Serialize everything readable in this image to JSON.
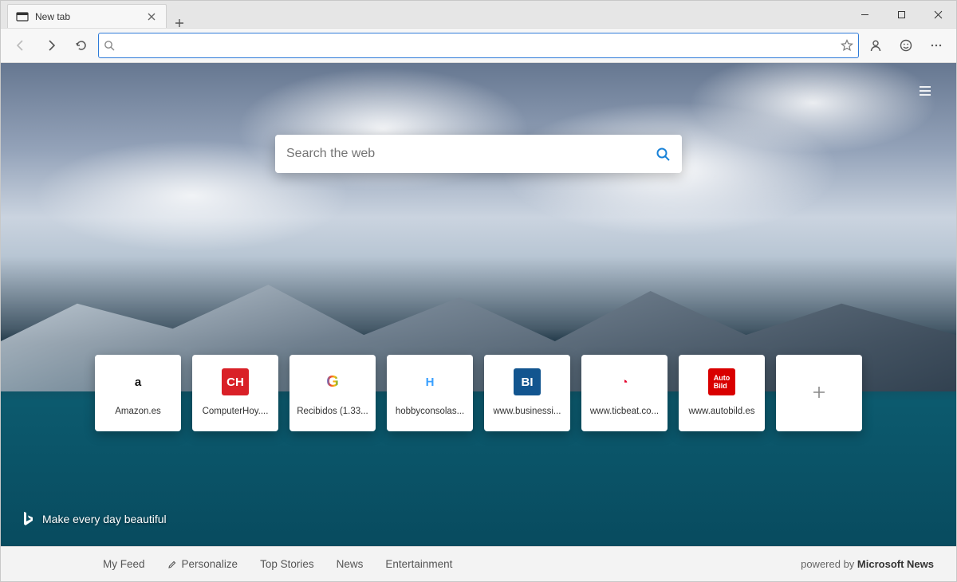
{
  "window": {
    "tab_title": "New tab"
  },
  "address_bar": {
    "value": "",
    "placeholder": ""
  },
  "page_search": {
    "placeholder": "Search the web"
  },
  "tiles": [
    {
      "label": "Amazon.es",
      "icon_text": "a",
      "icon_bg": "#ffffff",
      "icon_fg": "#111111"
    },
    {
      "label": "ComputerHoy....",
      "icon_text": "CH",
      "icon_bg": "#d92027",
      "icon_fg": "#ffffff"
    },
    {
      "label": "Recibidos (1.33...",
      "icon_text": "G",
      "icon_bg": "#ffffff",
      "icon_fg": "#4285f4"
    },
    {
      "label": "hobbyconsolas...",
      "icon_text": "H",
      "icon_bg": "#ffffff",
      "icon_fg": "#3aa0ff"
    },
    {
      "label": "www.businessi...",
      "icon_text": "BI",
      "icon_bg": "#12558f",
      "icon_fg": "#ffffff"
    },
    {
      "label": "www.ticbeat.co...",
      "icon_text": "◔",
      "icon_bg": "#ffffff",
      "icon_fg": "#e4002b"
    },
    {
      "label": "www.autobild.es",
      "icon_text": "Auto",
      "icon_bg": "#d90000",
      "icon_fg": "#ffffff"
    }
  ],
  "tagline": "Make every day beautiful",
  "footer": {
    "links": [
      "My Feed",
      "Personalize",
      "Top Stories",
      "News",
      "Entertainment"
    ],
    "powered_prefix": "powered by ",
    "powered_brand": "Microsoft News"
  }
}
